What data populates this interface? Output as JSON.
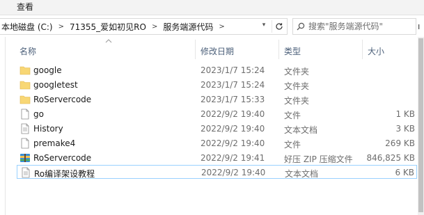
{
  "ribbon": {
    "view_tab": "查看"
  },
  "address": {
    "crumbs": [
      "本地磁盘 (C:)",
      "71355_爱如初见RO",
      "服务端源代码"
    ]
  },
  "search": {
    "placeholder": "搜索\"服务端源代码\"",
    "value": "",
    "edge_text": "ı"
  },
  "columns": {
    "name": "名称",
    "date": "修改日期",
    "type": "类型",
    "size": "大小"
  },
  "files": [
    {
      "name": "google",
      "date": "2023/1/7 15:24",
      "type": "文件夹",
      "size": "",
      "icon": "folder-icon"
    },
    {
      "name": "googletest",
      "date": "2023/1/7 15:24",
      "type": "文件夹",
      "size": "",
      "icon": "folder-icon"
    },
    {
      "name": "RoServercode",
      "date": "2023/1/7 15:33",
      "type": "文件夹",
      "size": "",
      "icon": "folder-icon"
    },
    {
      "name": "go",
      "date": "2022/9/2 19:40",
      "type": "文件",
      "size": "1 KB",
      "icon": "file-icon"
    },
    {
      "name": "History",
      "date": "2022/9/2 19:40",
      "type": "文本文档",
      "size": "3 KB",
      "icon": "text-file-icon"
    },
    {
      "name": "premake4",
      "date": "2022/9/2 19:40",
      "type": "文件",
      "size": "269 KB",
      "icon": "file-icon"
    },
    {
      "name": "RoServercode",
      "date": "2022/9/2 19:41",
      "type": "好压 ZIP 压缩文件",
      "size": "846,825 KB",
      "icon": "zip-archive-icon"
    },
    {
      "name": "Ro编译架设教程",
      "date": "2022/9/2 19:40",
      "type": "文本文档",
      "size": "6 KB",
      "icon": "text-file-icon"
    }
  ],
  "colors": {
    "folder": "#f8d775",
    "selection_border": "#99d1ff",
    "header_text": "#4c607a"
  }
}
